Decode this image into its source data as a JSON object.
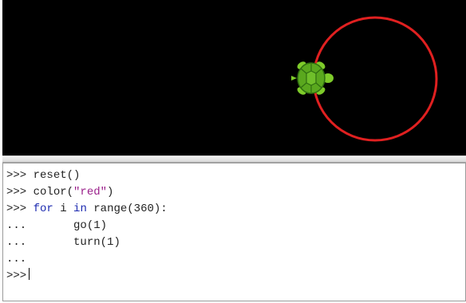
{
  "turtle_canvas": {
    "background_color": "#000000",
    "pen_color": "#e02020",
    "turtle_icon": "turtle-icon",
    "turtle_colors": {
      "shell": "#5aa81e",
      "shell_pattern": "#2f6e10",
      "skin": "#7ecb2a"
    }
  },
  "console": {
    "lines": [
      {
        "prompt": ">>> ",
        "parts": [
          {
            "text": "reset()",
            "style": "plain"
          }
        ]
      },
      {
        "prompt": ">>> ",
        "parts": [
          {
            "text": "color(",
            "style": "plain"
          },
          {
            "text": "\"red\"",
            "style": "str"
          },
          {
            "text": ")",
            "style": "plain"
          }
        ]
      },
      {
        "prompt": ">>> ",
        "parts": [
          {
            "text": "for",
            "style": "kw"
          },
          {
            "text": " i ",
            "style": "plain"
          },
          {
            "text": "in",
            "style": "kw"
          },
          {
            "text": " range(360):",
            "style": "plain"
          }
        ]
      },
      {
        "prompt": "...",
        "parts": [
          {
            "text": "      go(1)",
            "style": "plain"
          }
        ]
      },
      {
        "prompt": "...",
        "parts": [
          {
            "text": "      turn(1)",
            "style": "plain"
          }
        ]
      },
      {
        "prompt": "...",
        "parts": []
      },
      {
        "prompt": ">>>",
        "parts": []
      }
    ]
  }
}
